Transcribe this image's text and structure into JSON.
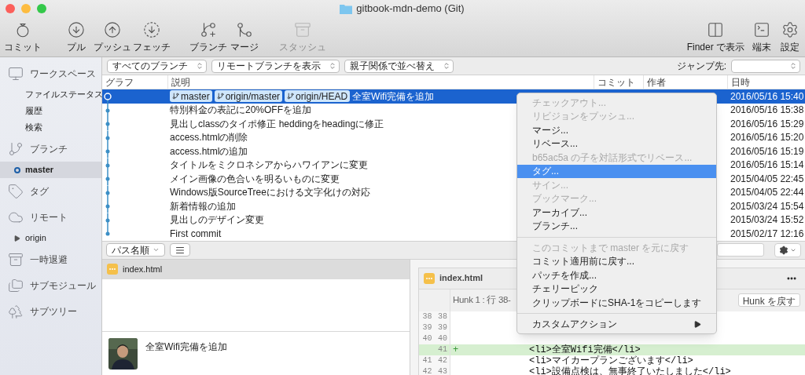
{
  "window": {
    "title": "gitbook-mdn-demo (Git)"
  },
  "toolbar": {
    "groups": [
      [
        {
          "kind": "commit",
          "label": "コミット",
          "disabled": false
        }
      ],
      [
        {
          "kind": "pull",
          "label": "プル",
          "disabled": false
        },
        {
          "kind": "push",
          "label": "プッシュ",
          "disabled": false
        },
        {
          "kind": "fetch",
          "label": "フェッチ",
          "disabled": false
        }
      ],
      [
        {
          "kind": "branch",
          "label": "ブランチ",
          "disabled": false
        },
        {
          "kind": "merge",
          "label": "マージ",
          "disabled": false
        }
      ],
      [
        {
          "kind": "stash",
          "label": "スタッシュ",
          "disabled": true
        }
      ]
    ],
    "right": [
      {
        "kind": "finder",
        "label": "Finder で表示"
      },
      {
        "kind": "terminal",
        "label": "端末"
      },
      {
        "kind": "settings",
        "label": "設定"
      }
    ]
  },
  "sidebar": {
    "sections": [
      {
        "kind": "workspace",
        "label": "ワークスペース",
        "items": [
          {
            "label": "ファイルステータス",
            "selected": false
          },
          {
            "label": "履歴",
            "selected": false
          },
          {
            "label": "検索",
            "selected": false
          }
        ]
      },
      {
        "kind": "branches",
        "label": "ブランチ",
        "items": [
          {
            "label": "master",
            "selected": true,
            "current": true
          }
        ]
      },
      {
        "kind": "tags",
        "label": "タグ"
      },
      {
        "kind": "remotes",
        "label": "リモート",
        "items": [
          {
            "label": "origin",
            "selected": false,
            "expanded": false
          }
        ]
      },
      {
        "kind": "stashes",
        "label": "一時退避"
      },
      {
        "kind": "submodules",
        "label": "サブモジュール"
      },
      {
        "kind": "subtrees",
        "label": "サブツリー"
      }
    ]
  },
  "filters": {
    "dropdowns": [
      "すべてのブランチ",
      "リモートブランチを表示",
      "親子関係で並べ替え"
    ],
    "jump_label": "ジャンプ先:"
  },
  "table": {
    "columns": [
      "グラフ",
      "説明",
      "コミット",
      "作者",
      "日時"
    ],
    "rows": [
      {
        "refs": [
          "master",
          "origin/master",
          "origin/HEAD"
        ],
        "message": "全室Wifi完備を追加",
        "date": "2016/05/16 15:40",
        "selected": true
      },
      {
        "message": "特別料金の表記に20%OFFを追加",
        "date": "2016/05/16 15:38",
        "selected": false
      },
      {
        "message": "見出しclassのタイポ修正 heddingをheadingに修正",
        "date": "2016/05/16 15:29",
        "selected": false
      },
      {
        "message": "access.htmlの削除",
        "date": "2016/05/16 15:20",
        "selected": false
      },
      {
        "message": "access.htmlの追加",
        "date": "2016/05/16 15:19",
        "selected": false
      },
      {
        "message": "タイトルをミクロネシアからハワイアンに変更",
        "date": "2016/05/16 15:14",
        "selected": false
      },
      {
        "message": "メイン画像の色合いを明るいものに変更",
        "date": "2015/04/05 22:45",
        "selected": false
      },
      {
        "message": "Windows版SourceTreeにおける文字化けの対応",
        "date": "2015/04/05 22:44",
        "selected": false
      },
      {
        "message": "新着情報の追加",
        "date": "2015/03/24 15:54",
        "selected": false
      },
      {
        "message": "見出しのデザイン変更",
        "date": "2015/03/24 15:52",
        "selected": false
      },
      {
        "message": "First commit",
        "date": "2015/02/17 12:16",
        "selected": false
      }
    ]
  },
  "file_bar": {
    "sort": "パス名順"
  },
  "files": [
    {
      "name": "index.html",
      "selected": true
    }
  ],
  "commit_detail": {
    "message": "全室Wifi完備を追加"
  },
  "diff": {
    "file": "index.html",
    "hunk": "Hunk 1 : 行 38-",
    "revert_button": "Hunk を戻す",
    "lines": [
      {
        "kind": "context",
        "old": "38",
        "new": "38"
      },
      {
        "kind": "context",
        "old": "39",
        "new": "39"
      },
      {
        "kind": "context",
        "old": "40",
        "new": "40"
      },
      {
        "kind": "added",
        "new": "41",
        "sign": "+",
        "text": "<li>全室Wifi完備</li>"
      },
      {
        "kind": "context",
        "old": "41",
        "new": "42",
        "text": "<li>マイカープランございます</li>"
      },
      {
        "kind": "context",
        "old": "42",
        "new": "43",
        "text": "<li>設備点検は、無事終了いたしました</li>"
      }
    ]
  },
  "context_menu": [
    {
      "kind": "item",
      "label": "チェックアウト...",
      "disabled": true,
      "selected": false
    },
    {
      "kind": "item",
      "label": "リビジョンをプッシュ...",
      "disabled": true,
      "selected": false
    },
    {
      "kind": "item",
      "label": "マージ...",
      "disabled": false,
      "selected": false
    },
    {
      "kind": "item",
      "label": "リベース...",
      "disabled": false,
      "selected": false
    },
    {
      "kind": "item",
      "label": "b65ac5a の子を対話形式でリベース...",
      "disabled": true,
      "selected": false
    },
    {
      "kind": "item",
      "label": "タグ...",
      "disabled": false,
      "selected": true
    },
    {
      "kind": "item",
      "label": "サイン...",
      "disabled": true,
      "selected": false
    },
    {
      "kind": "item",
      "label": "ブックマーク...",
      "disabled": true,
      "selected": false
    },
    {
      "kind": "item",
      "label": "アーカイブ...",
      "disabled": false,
      "selected": false
    },
    {
      "kind": "item",
      "label": "ブランチ...",
      "disabled": false,
      "selected": false
    },
    {
      "kind": "separator"
    },
    {
      "kind": "item",
      "label": "このコミットまで master を元に戻す",
      "disabled": true,
      "selected": false
    },
    {
      "kind": "item",
      "label": "コミット適用前に戻す...",
      "disabled": false,
      "selected": false
    },
    {
      "kind": "item",
      "label": "パッチを作成...",
      "disabled": false,
      "selected": false
    },
    {
      "kind": "item",
      "label": "チェリーピック",
      "disabled": false,
      "selected": false
    },
    {
      "kind": "item",
      "label": "クリップボードにSHA-1をコピーします",
      "disabled": false,
      "selected": false
    },
    {
      "kind": "separator"
    },
    {
      "kind": "submenu",
      "label": "カスタムアクション",
      "disabled": false,
      "selected": false
    }
  ]
}
